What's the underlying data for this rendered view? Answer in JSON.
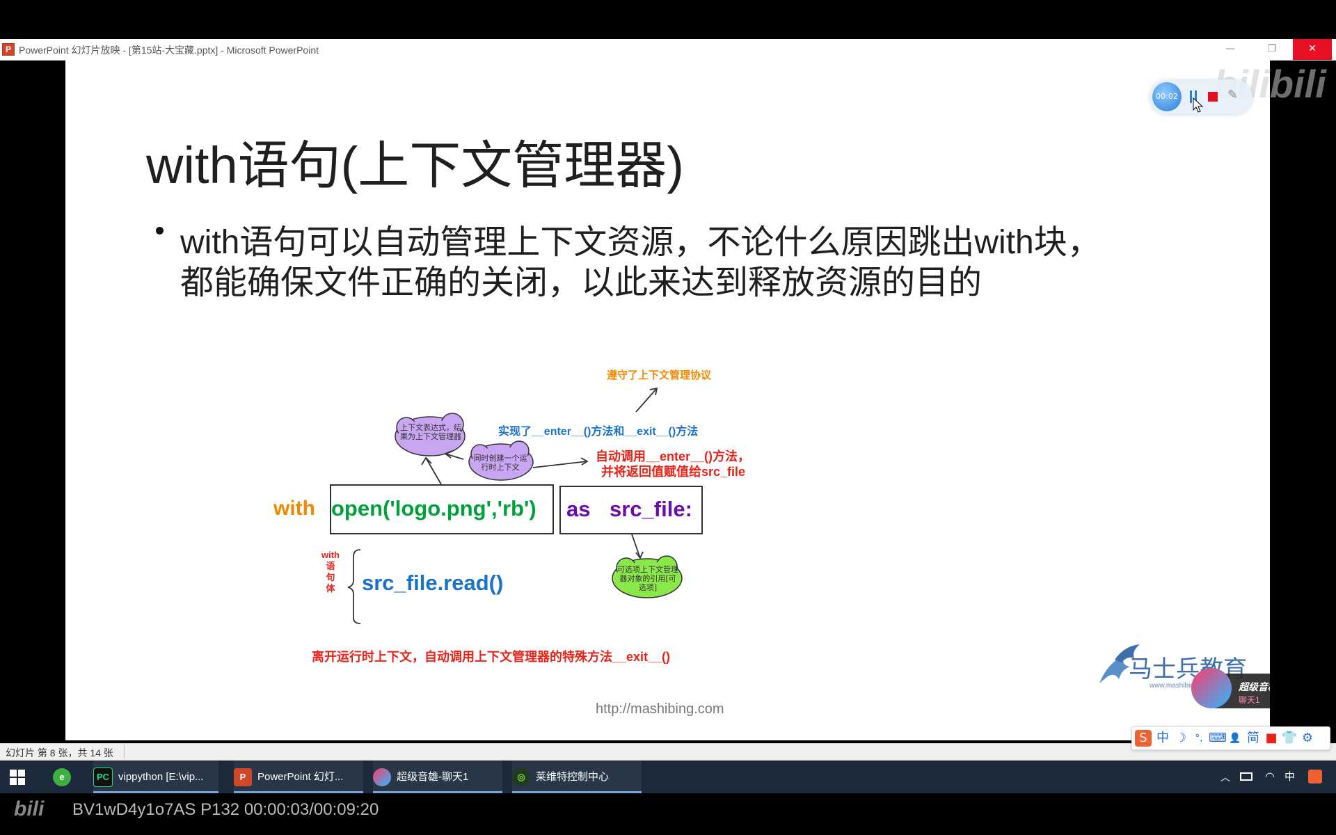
{
  "window": {
    "icon_letter": "P",
    "title": "PowerPoint 幻灯片放映 - [第15站-大宝藏.pptx] - Microsoft PowerPoint",
    "minimize": "—",
    "restore": "❐",
    "close": "✕"
  },
  "slide": {
    "title": "with语句(上下文管理器)",
    "bullet_line1": "with语句可以自动管理上下文资源，不论什么原因跳出with块，",
    "bullet_line2": "都能确保文件正确的关闭，以此来达到释放资源的目的",
    "url": "http://mashibing.com",
    "logo_text": "马士兵教育",
    "logo_sub": "www.mashibing.com"
  },
  "diagram": {
    "protocol_note": "遵守了上下文管理协议",
    "impl_note": "实现了__enter__()方法和__exit__()方法",
    "cloud1": "上下文表达式，结果为上下文管理器",
    "cloud2": "同时创建一个运行时上下文",
    "enter_note_line1": "自动调用__enter__()方法，",
    "enter_note_line2": "并将返回值赋值给src_file",
    "kw_with": "with",
    "expr": "open('logo.png','rb')",
    "kw_as": "as",
    "target": "src_file:",
    "body_label": [
      "with",
      "语",
      "句",
      "体"
    ],
    "body_code": "src_file.read()",
    "cloud3": "可选项上下文管理器对象的引用[可选项]",
    "exit_note": "离开运行时上下文，自动调用上下文管理器的特殊方法__exit__()"
  },
  "recorder": {
    "timer": "00:02",
    "watermark": "bilibili"
  },
  "music_popup": {
    "title": "超级音雄",
    "subtitle": "聊天1"
  },
  "statusbar": {
    "text": "幻灯片 第 8 张，共 14 张"
  },
  "ime": {
    "items": [
      "中",
      "☽",
      "°,",
      "⌨",
      "👤",
      "简",
      "■",
      "👕",
      "⚙"
    ]
  },
  "taskbar": {
    "start_icon": "windows-logo",
    "items": [
      {
        "label": "",
        "icon": "browser-icon"
      },
      {
        "label": "vippython [E:\\vip...",
        "icon": "pycharm-icon"
      },
      {
        "label": "PowerPoint 幻灯...",
        "icon": "powerpoint-icon"
      },
      {
        "label": "超级音雄-聊天1",
        "icon": "music-app-icon"
      },
      {
        "label": "莱维特控制中心",
        "icon": "control-center-icon"
      }
    ],
    "tray_ime": "中"
  },
  "video_info": "BV1wD4y1o7AS P132 00:00:03/00:09:20",
  "colors": {
    "orange": "#f28a00",
    "green": "#00a13a",
    "purple": "#6a0dad",
    "blue": "#1a73c8",
    "red": "#e8241a",
    "cloud_purple": "#c9a6f2",
    "cloud_green": "#8be84a"
  }
}
